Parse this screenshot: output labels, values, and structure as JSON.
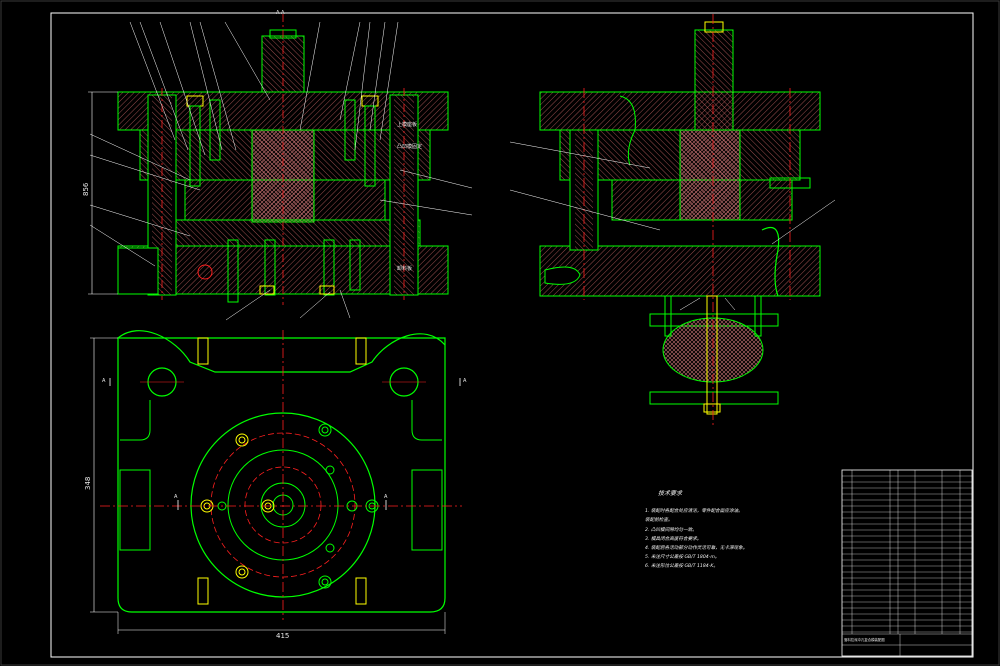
{
  "drawing": {
    "dimensions": {
      "front_height": "856",
      "plan_height": "348",
      "plan_width": "415",
      "section_top": "A-A"
    },
    "section_marks": {
      "plan_left": "A",
      "plan_right": "A",
      "plan_bottom_left": "A",
      "plan_bottom_right": "A"
    },
    "front_view_inline_labels": [
      "上模座板",
      "凸凹模固定",
      "卸料板"
    ],
    "technical_requirements": {
      "title": "技术要求",
      "items": [
        "1. 装配时各配合处应清洁，零件配合面应涂油。",
        "   装配前检查。",
        "2. 凸凹模间隙均匀一致。",
        "3. 模具闭合高度符合要求。",
        "4. 装配后各活动部分动作灵活可靠，无卡滞现象。",
        "5. 未注尺寸公差按 GB/T 1804-m。",
        "6. 未注形位公差按 GB/T 1184-K。"
      ]
    },
    "title_block": {
      "caption": "落料拉深冲孔复合模装配图"
    }
  },
  "colors": {
    "background": "#000000",
    "frame": "#ffffff",
    "green": "#00ff00",
    "red": "#ff2020",
    "yellow": "#ffff00",
    "hatch": "#ff8c8c",
    "white": "#ffffff"
  }
}
